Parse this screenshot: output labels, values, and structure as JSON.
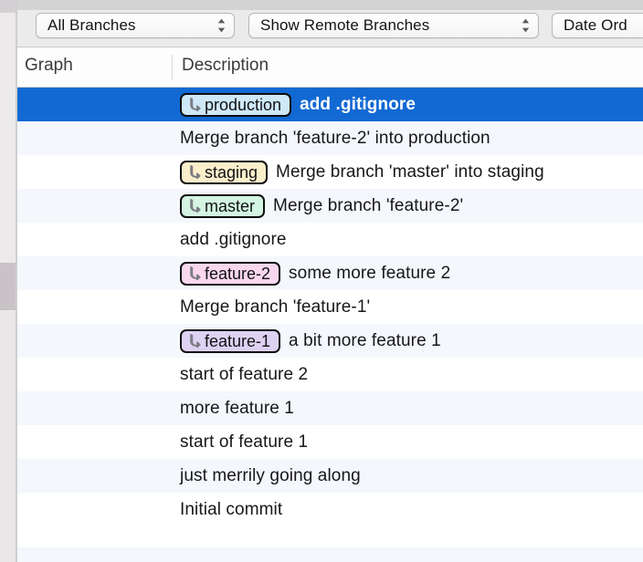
{
  "window": {
    "left_strip": {
      "name": "window-edge-strip"
    }
  },
  "toolbar": {
    "branch_filter": {
      "label": "All Branches",
      "icon": "updown-chevron-icon"
    },
    "remote_filter": {
      "label": "Show Remote Branches",
      "icon": "updown-chevron-icon"
    },
    "order_filter": {
      "label": "Date Ord",
      "icon": "updown-chevron-icon"
    }
  },
  "columns": {
    "graph": "Graph",
    "description": "Description"
  },
  "colors": {
    "selection": "#1269d3",
    "row_alt": "#f4f7fb",
    "lane_blue": "#5b9ec0",
    "lane_magenta": "#cd72c0",
    "lane_gold": "#c8a84e",
    "lane_green": "#51bd96",
    "lane_purple": "#7e5fc6",
    "badge_production": "#cfe8f8",
    "badge_staging": "#fbeecb",
    "badge_master": "#d3f5e2",
    "badge_feature2": "#f9d7ee",
    "badge_feature1": "#ddd2f2"
  },
  "rows": [
    {
      "index": 0,
      "badge": "production",
      "badge_color": "#cfe8f8",
      "message": "add .gitignore",
      "selected": true,
      "node_lane": 0,
      "node_color": "#5b9ec0",
      "is_head": true
    },
    {
      "index": 1,
      "badge": null,
      "badge_color": null,
      "message": "Merge branch 'feature-2' into production",
      "selected": false,
      "node_lane": 0,
      "node_color": "#5b9ec0",
      "is_head": false
    },
    {
      "index": 2,
      "badge": "staging",
      "badge_color": "#fbeecb",
      "message": "Merge branch 'master' into staging",
      "selected": false,
      "node_lane": 2,
      "node_color": "#c8a84e",
      "is_head": false
    },
    {
      "index": 3,
      "badge": "master",
      "badge_color": "#d3f5e2",
      "message": "Merge branch 'feature-2'",
      "selected": false,
      "node_lane": 3,
      "node_color": "#51bd96",
      "is_head": false
    },
    {
      "index": 4,
      "badge": null,
      "badge_color": null,
      "message": "add .gitignore",
      "selected": false,
      "node_lane": 3,
      "node_color": "#51bd96",
      "is_head": false
    },
    {
      "index": 5,
      "badge": "feature-2",
      "badge_color": "#f9d7ee",
      "message": "some more feature 2",
      "selected": false,
      "node_lane": 1,
      "node_color": "#cd72c0",
      "is_head": false
    },
    {
      "index": 6,
      "badge": null,
      "badge_color": null,
      "message": "Merge branch 'feature-1'",
      "selected": false,
      "node_lane": 3,
      "node_color": "#51bd96",
      "is_head": false
    },
    {
      "index": 7,
      "badge": "feature-1",
      "badge_color": "#ddd2f2",
      "message": "a bit more feature 1",
      "selected": false,
      "node_lane": 4,
      "node_color": "#7e5fc6",
      "is_head": false
    },
    {
      "index": 8,
      "badge": null,
      "badge_color": null,
      "message": "start of feature 2",
      "selected": false,
      "node_lane": 1,
      "node_color": "#cd72c0",
      "is_head": false
    },
    {
      "index": 9,
      "badge": null,
      "badge_color": null,
      "message": "more feature 1",
      "selected": false,
      "node_lane": 3,
      "node_color": "#51bd96",
      "is_head": false
    },
    {
      "index": 10,
      "badge": null,
      "badge_color": null,
      "message": "start of feature 1",
      "selected": false,
      "node_lane": 3,
      "node_color": "#51bd96",
      "is_head": false
    },
    {
      "index": 11,
      "badge": null,
      "badge_color": null,
      "message": "just merrily going along",
      "selected": false,
      "node_lane": 0,
      "node_color": "#5b9ec0",
      "is_head": false
    },
    {
      "index": 12,
      "badge": null,
      "badge_color": null,
      "message": "Initial commit",
      "selected": false,
      "node_lane": 0,
      "node_color": "#5b9ec0",
      "is_head": false
    }
  ]
}
